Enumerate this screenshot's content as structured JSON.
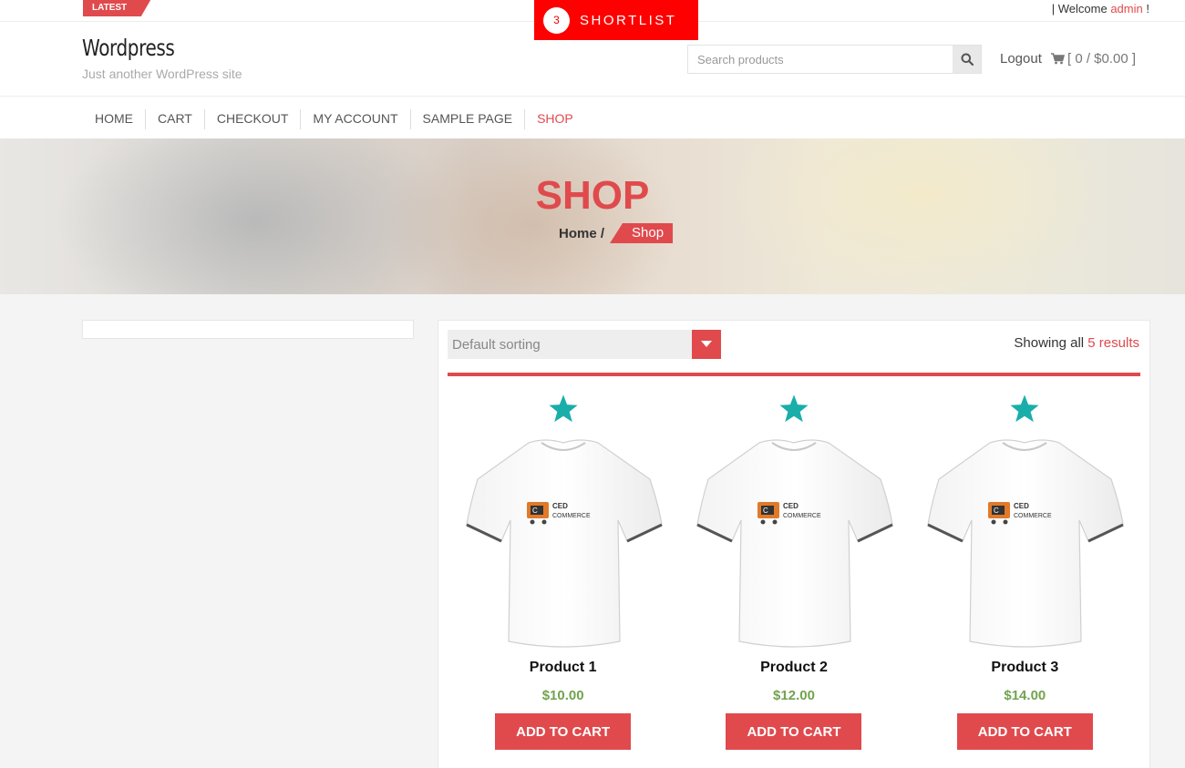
{
  "topbar": {
    "latest_label": "LATEST",
    "shortlist_count": "3",
    "shortlist_label": "SHORTLIST",
    "welcome_prefix": "| Welcome",
    "welcome_user": "admin",
    "welcome_suffix": "!"
  },
  "header": {
    "site_title": "Wordpress",
    "tagline": "Just another WordPress site",
    "search_placeholder": "Search products",
    "logout_label": "Logout",
    "cart_summary": "[ 0 / $0.00 ]"
  },
  "nav": {
    "items": [
      {
        "label": "HOME"
      },
      {
        "label": "CART"
      },
      {
        "label": "CHECKOUT"
      },
      {
        "label": "MY ACCOUNT"
      },
      {
        "label": "SAMPLE PAGE"
      },
      {
        "label": "SHOP",
        "active": true
      }
    ]
  },
  "hero": {
    "title": "SHOP",
    "breadcrumb_home": "Home /",
    "breadcrumb_current": "Shop"
  },
  "shop": {
    "sort_value": "Default sorting",
    "results_prefix": "Showing all",
    "results_count": "5 results"
  },
  "products": [
    {
      "name": "Product 1",
      "price": "$10.00",
      "button": "ADD TO CART",
      "logo_top": "CED",
      "logo_bottom": "COMMERCE"
    },
    {
      "name": "Product 2",
      "price": "$12.00",
      "button": "ADD TO CART",
      "logo_top": "CED",
      "logo_bottom": "COMMERCE"
    },
    {
      "name": "Product 3",
      "price": "$14.00",
      "button": "ADD TO CART",
      "logo_top": "CED",
      "logo_bottom": "COMMERCE"
    }
  ],
  "colors": {
    "accent": "#e04a4d",
    "shortlist": "#ff0000",
    "star": "#19aeaa",
    "price": "#72a34e"
  },
  "icons": {
    "search": "search-icon",
    "cart": "cart-icon",
    "sort_arrow": "chevron-down-icon",
    "favorite": "star-icon"
  }
}
